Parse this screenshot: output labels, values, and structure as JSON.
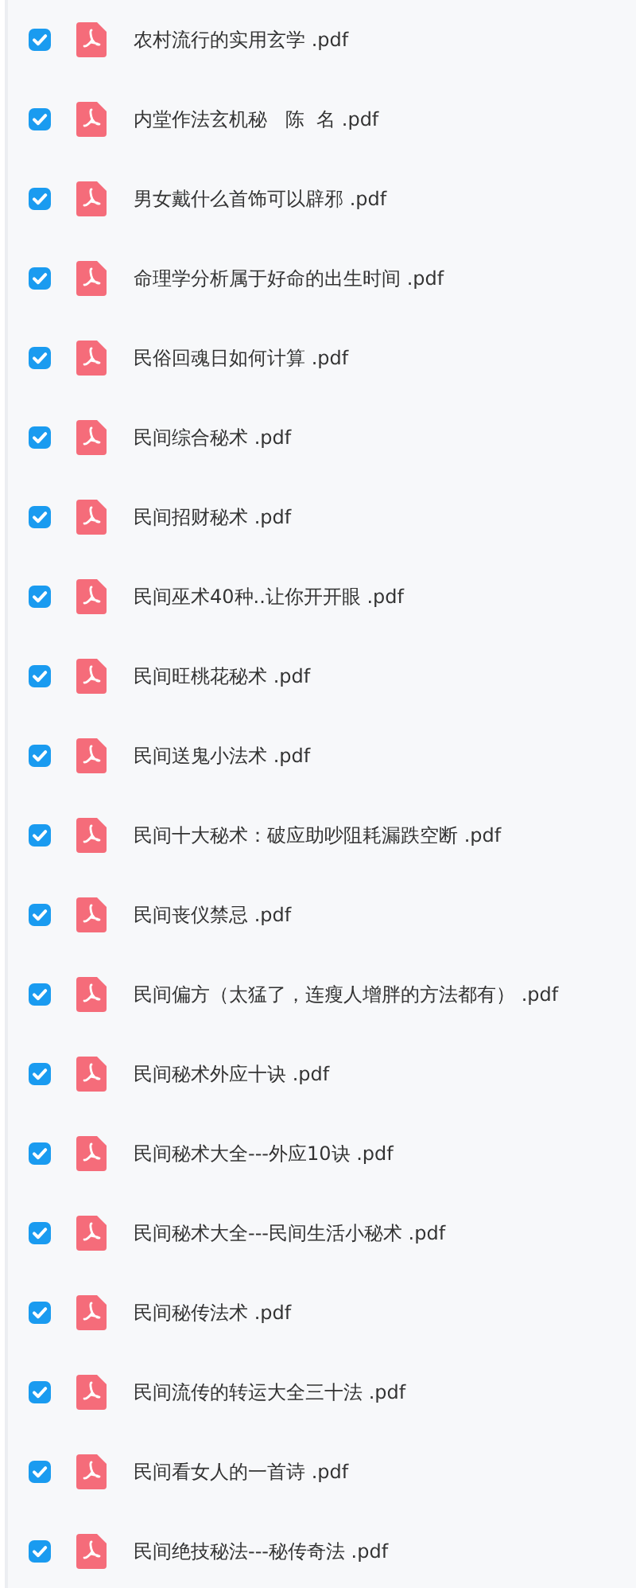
{
  "files": [
    {
      "name": "农村流行的实用玄学 .pdf",
      "checked": true
    },
    {
      "name": "内堂作法玄机秘   陈  名 .pdf",
      "checked": true
    },
    {
      "name": "男女戴什么首饰可以辟邪 .pdf",
      "checked": true
    },
    {
      "name": "命理学分析属于好命的出生时间 .pdf",
      "checked": true
    },
    {
      "name": "民俗回魂日如何计算 .pdf",
      "checked": true
    },
    {
      "name": "民间综合秘术 .pdf",
      "checked": true
    },
    {
      "name": "民间招财秘术 .pdf",
      "checked": true
    },
    {
      "name": "民间巫术40种..让你开开眼 .pdf",
      "checked": true
    },
    {
      "name": "民间旺桃花秘术 .pdf",
      "checked": true
    },
    {
      "name": "民间送鬼小法术 .pdf",
      "checked": true
    },
    {
      "name": "民间十大秘术：破应助吵阻耗漏跌空断 .pdf",
      "checked": true
    },
    {
      "name": "民间丧仪禁忌 .pdf",
      "checked": true
    },
    {
      "name": "民间偏方（太猛了，连瘦人增胖的方法都有） .pdf",
      "checked": true
    },
    {
      "name": "民间秘术外应十诀 .pdf",
      "checked": true
    },
    {
      "name": "民间秘术大全---外应10诀 .pdf",
      "checked": true
    },
    {
      "name": "民间秘术大全---民间生活小秘术 .pdf",
      "checked": true
    },
    {
      "name": "民间秘传法术 .pdf",
      "checked": true
    },
    {
      "name": "民间流传的转运大全三十法 .pdf",
      "checked": true
    },
    {
      "name": "民间看女人的一首诗 .pdf",
      "checked": true
    },
    {
      "name": "民间绝技秘法---秘传奇法 .pdf",
      "checked": true
    }
  ]
}
